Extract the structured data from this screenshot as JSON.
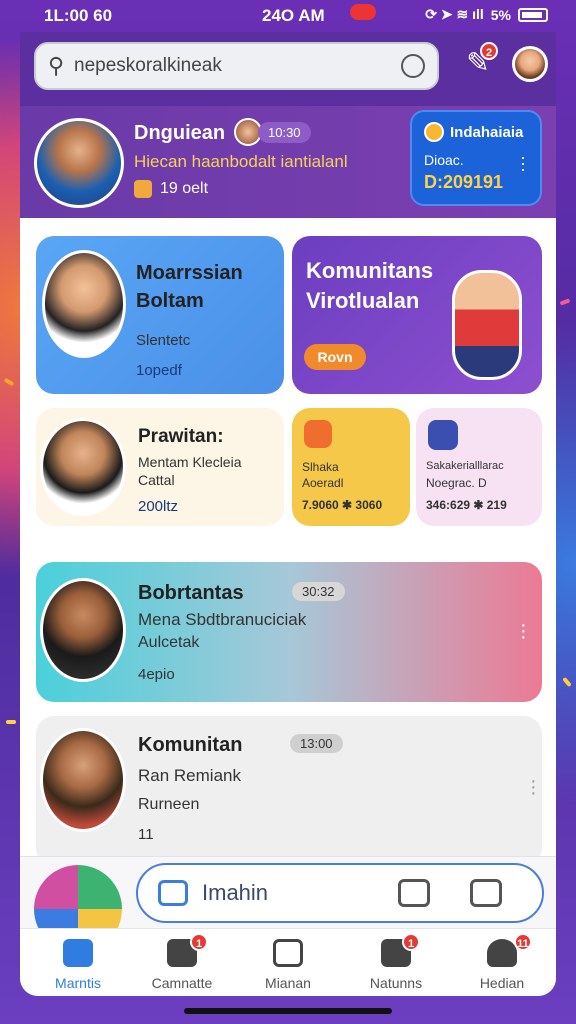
{
  "status": {
    "time": "1L:00 60",
    "clock": "24O AM",
    "battery": "5%"
  },
  "search": {
    "value": "nepeskoralkineak"
  },
  "header": {
    "notif_badge": "2"
  },
  "profile": {
    "name": "Dnguiean",
    "time": "10:30",
    "subtitle": "Hiecan haanbodalt iantialanl",
    "count": "19 oelt",
    "card": {
      "title": "Indahaiaia",
      "sub": "Dioac.",
      "value": "D:209191"
    }
  },
  "cards": {
    "c1": {
      "title": "Moarrssian",
      "title2": "Boltam",
      "line": "Slentetc",
      "meta": "1opedf"
    },
    "c2": {
      "title": "Komunitans",
      "title2": "Virotlualan",
      "button": "Rovn"
    },
    "c3": {
      "title": "Prawitan:",
      "line1": "Mentam Klecleia",
      "line2": "Cattal",
      "meta": "200ltz"
    },
    "c4": {
      "line1": "Slhaka",
      "line2": "Aoeradl",
      "meta": "7.9060 ✱ 3060"
    },
    "c5": {
      "line1": "Sakakerialllarac",
      "line2": "Noegrac. D",
      "meta": "346:629 ✱ 219"
    },
    "c6": {
      "title": "Bobrtantas",
      "time": "30:32",
      "line1": "Mena Sbdtbranuciciak",
      "line2": "Aulcetak",
      "meta": "4epio"
    },
    "c7": {
      "title": "Komunitan",
      "time": "13:00",
      "line1": "Ran Remiank",
      "line2": "Rurneen",
      "meta": "11"
    }
  },
  "cta": {
    "label": "Imahin"
  },
  "tabs": [
    {
      "label": "Marntis",
      "badge": ""
    },
    {
      "label": "Camnatte",
      "badge": "1"
    },
    {
      "label": "Mianan",
      "badge": ""
    },
    {
      "label": "Natunns",
      "badge": "1"
    },
    {
      "label": "Hedian",
      "badge": "11"
    }
  ]
}
